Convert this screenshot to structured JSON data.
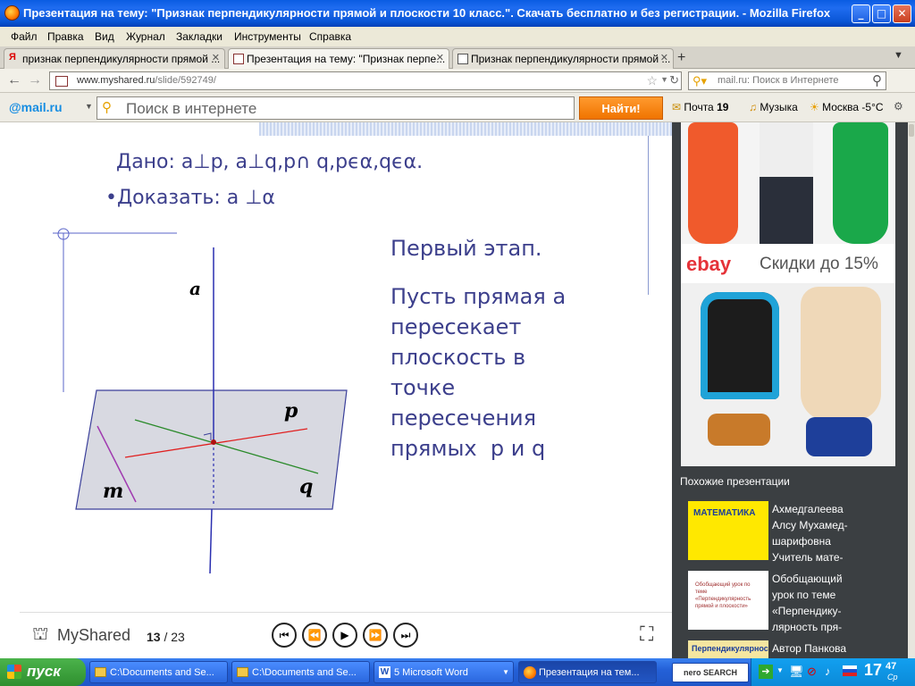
{
  "window": {
    "title": "Презентация на тему: \"Признак перпендикулярности прямой и плоскости 10 класс.\". Скачать бесплатно и без регистрации. - Mozilla Firefox",
    "min": "_",
    "max": "□",
    "close": "✕"
  },
  "menu": [
    "Файл",
    "Правка",
    "Вид",
    "Журнал",
    "Закладки",
    "Инструменты",
    "Справка"
  ],
  "tabs": [
    {
      "label": "признак перпендикулярности прямой ..."
    },
    {
      "label": "Презентация на тему: \"Признак перпе..."
    },
    {
      "label": "Признак перпендикулярности прямой ..."
    }
  ],
  "new_tab": "+",
  "nav": {
    "url_host": "www.myshared.ru",
    "url_path": "/slide/592749/",
    "search_placeholder": "mail.ru: Поиск в Интернете"
  },
  "mailbar": {
    "logo": "@mail.ru",
    "search_placeholder": "Поиск в интернете",
    "find_button": "Найти!",
    "mail": "Почта",
    "mail_count": "19",
    "music": "Музыка",
    "weather": "Москва -5°C"
  },
  "slide": {
    "given": "Дано: a⊥p, a⊥q,p∩ q,pϵα,qϵα.",
    "prove": "•Доказать: a ⊥α",
    "stage": "Первый этап.",
    "body": [
      "Пусть прямая a",
      "пересекает",
      "плоскость в",
      "точке",
      "пересечения",
      "прямых  p и q"
    ],
    "label_a": "a",
    "label_p": "p",
    "label_q": "q",
    "label_m": "m",
    "brand": "MyShared",
    "page_current": "13",
    "page_sep": "/ 23"
  },
  "ad": {
    "ebay": "ebay",
    "discount": "Скидки до 15%"
  },
  "similar": {
    "heading": "Похожие презентации",
    "items": [
      {
        "thumb_title": "МАТЕМАТИКА",
        "text": [
          "Ахмедгалеева",
          "Алсу Мухамед-",
          "шарифовна",
          "Учитель мате-"
        ]
      },
      {
        "thumb_title": "Обобщающий урок по теме «Перпендикулярность прямой и плоскости»",
        "text": [
          "Обобщающий",
          "урок по теме",
          "«Перпендику-",
          "лярность пря-"
        ]
      },
      {
        "thumb_title": "Перпендикулярность",
        "text": [
          "Автор Панкова"
        ]
      }
    ]
  },
  "taskbar": {
    "start": "пуск",
    "tasks": [
      "C:\\Documents and Se...",
      "C:\\Documents and Se...",
      "5 Microsoft Word",
      "Презентация на тем..."
    ],
    "nero": "nero SEARCH",
    "clock_h": "17",
    "clock_m": "47",
    "clock_day": "Ср"
  },
  "colors": {
    "slide_text": "#3c3f8c",
    "taskbar": "#2461d8",
    "find_button": "#f07400"
  }
}
